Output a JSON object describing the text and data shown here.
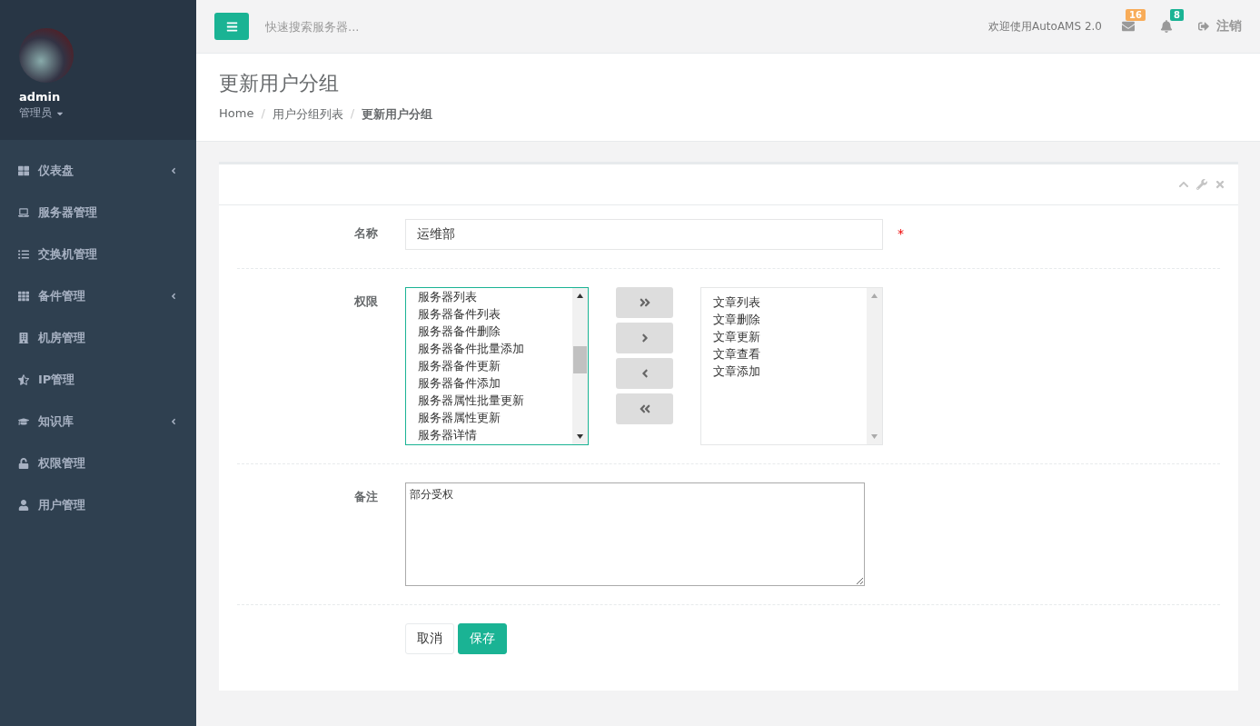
{
  "user": {
    "name": "admin",
    "role": "管理员"
  },
  "sidebar": {
    "items": [
      {
        "label": "仪表盘",
        "expandable": true
      },
      {
        "label": "服务器管理",
        "expandable": false
      },
      {
        "label": "交换机管理",
        "expandable": false
      },
      {
        "label": "备件管理",
        "expandable": true
      },
      {
        "label": "机房管理",
        "expandable": false
      },
      {
        "label": "IP管理",
        "expandable": false
      },
      {
        "label": "知识库",
        "expandable": true
      },
      {
        "label": "权限管理",
        "expandable": false
      },
      {
        "label": "用户管理",
        "expandable": false
      }
    ]
  },
  "topbar": {
    "search": {
      "placeholder": "快速搜索服务器..."
    },
    "welcome": "欢迎使用AutoAMS 2.0",
    "mail_count": "16",
    "alert_count": "8",
    "logout": "注销"
  },
  "page": {
    "title": "更新用户分组",
    "breadcrumb_separator": "/",
    "breadcrumb": [
      {
        "label": "Home",
        "current": false
      },
      {
        "label": "用户分组列表",
        "current": false
      },
      {
        "label": "更新用户分组",
        "current": true
      }
    ]
  },
  "form": {
    "name": {
      "label": "名称",
      "value": "运维部",
      "required": true,
      "required_mark": "*"
    },
    "permissions": {
      "label": "权限",
      "available": [
        "服务器列表",
        "服务器备件列表",
        "服务器备件删除",
        "服务器备件批量添加",
        "服务器备件更新",
        "服务器备件添加",
        "服务器属性批量更新",
        "服务器属性更新",
        "服务器详情"
      ],
      "chosen": [
        "文章列表",
        "文章删除",
        "文章更新",
        "文章查看",
        "文章添加"
      ]
    },
    "note": {
      "label": "备注",
      "value": "部分受权"
    },
    "buttons": [
      {
        "label": "取消",
        "kind": "default"
      },
      {
        "label": "保存",
        "kind": "primary"
      }
    ]
  }
}
